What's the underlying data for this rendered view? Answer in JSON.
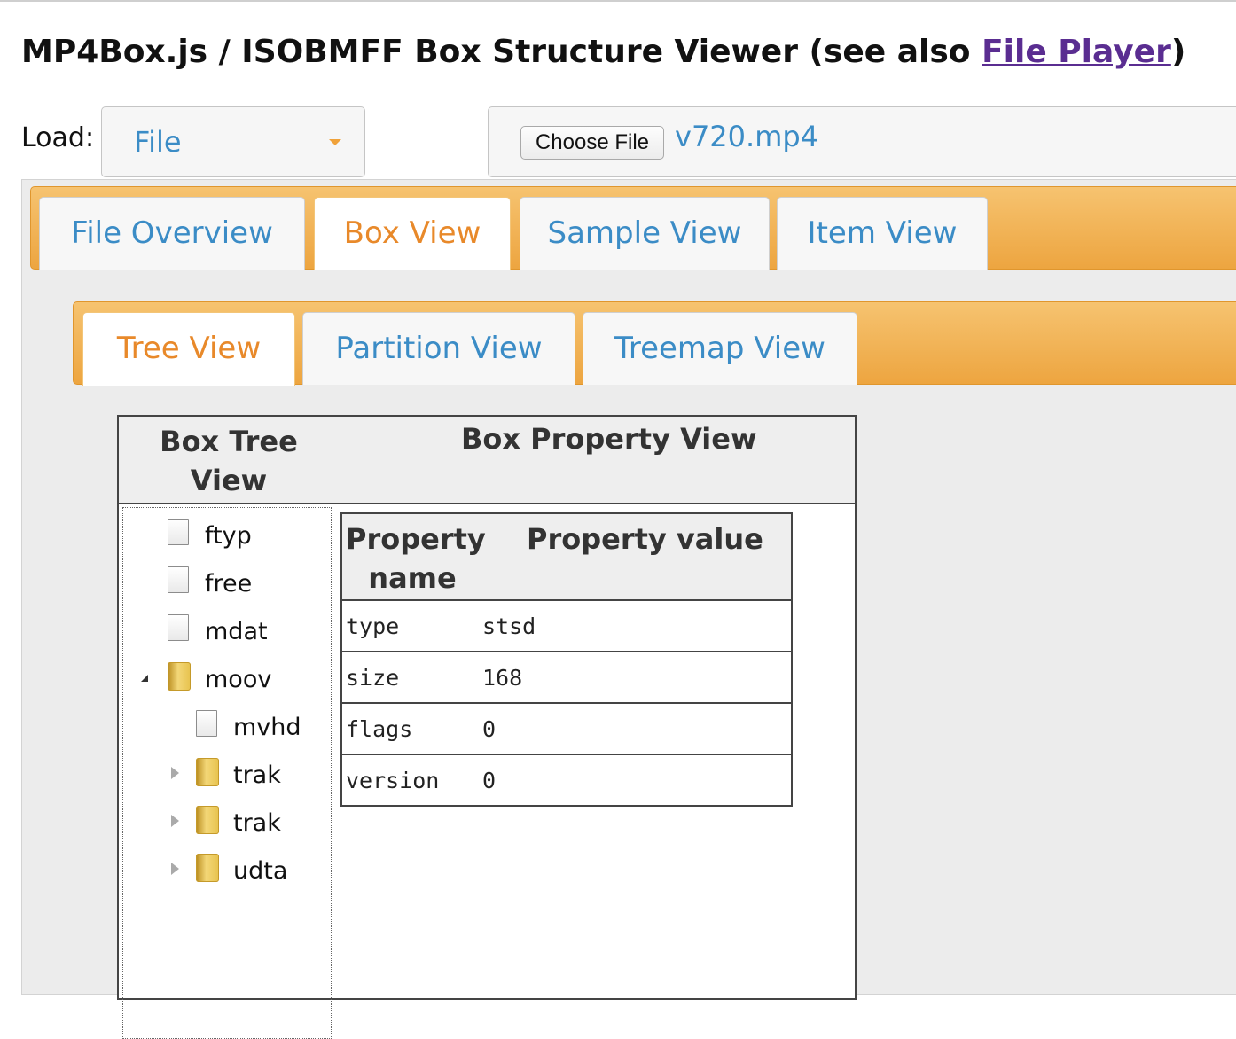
{
  "title": {
    "prefix": "MP4Box.js / ISOBMFF Box Structure Viewer (see also ",
    "link": "File Player",
    "suffix": ")"
  },
  "load": {
    "label": "Load:",
    "selected": "File",
    "choose_file_label": "Choose File",
    "file_name": "v720.mp4"
  },
  "main_tabs": [
    {
      "label": "File Overview",
      "active": false
    },
    {
      "label": "Box View",
      "active": true
    },
    {
      "label": "Sample View",
      "active": false
    },
    {
      "label": "Item View",
      "active": false
    }
  ],
  "sub_tabs": [
    {
      "label": "Tree View",
      "active": true
    },
    {
      "label": "Partition View",
      "active": false
    },
    {
      "label": "Treemap View",
      "active": false
    }
  ],
  "box_table": {
    "tree_header": "Box Tree View",
    "property_header": "Box Property View"
  },
  "tree": [
    {
      "name": "ftyp",
      "type": "file",
      "expander": "none"
    },
    {
      "name": "free",
      "type": "file",
      "expander": "none"
    },
    {
      "name": "mdat",
      "type": "file",
      "expander": "none"
    },
    {
      "name": "moov",
      "type": "folder",
      "expander": "expanded"
    },
    {
      "name": "mvhd",
      "type": "file",
      "expander": "none"
    },
    {
      "name": "trak",
      "type": "folder",
      "expander": "collapsed"
    },
    {
      "name": "trak",
      "type": "folder",
      "expander": "collapsed"
    },
    {
      "name": "udta",
      "type": "folder",
      "expander": "collapsed"
    }
  ],
  "properties": {
    "name_header": "Property name",
    "value_header": "Property value",
    "rows": [
      {
        "name": "type",
        "value": "stsd"
      },
      {
        "name": "size",
        "value": "168"
      },
      {
        "name": "flags",
        "value": "0"
      },
      {
        "name": "version",
        "value": "0"
      }
    ]
  },
  "colors": {
    "tab_text": "#3b8cc6",
    "active_tab_text": "#e8892a",
    "tab_bar": "#f0ad4e",
    "link": "#5a2d91"
  }
}
